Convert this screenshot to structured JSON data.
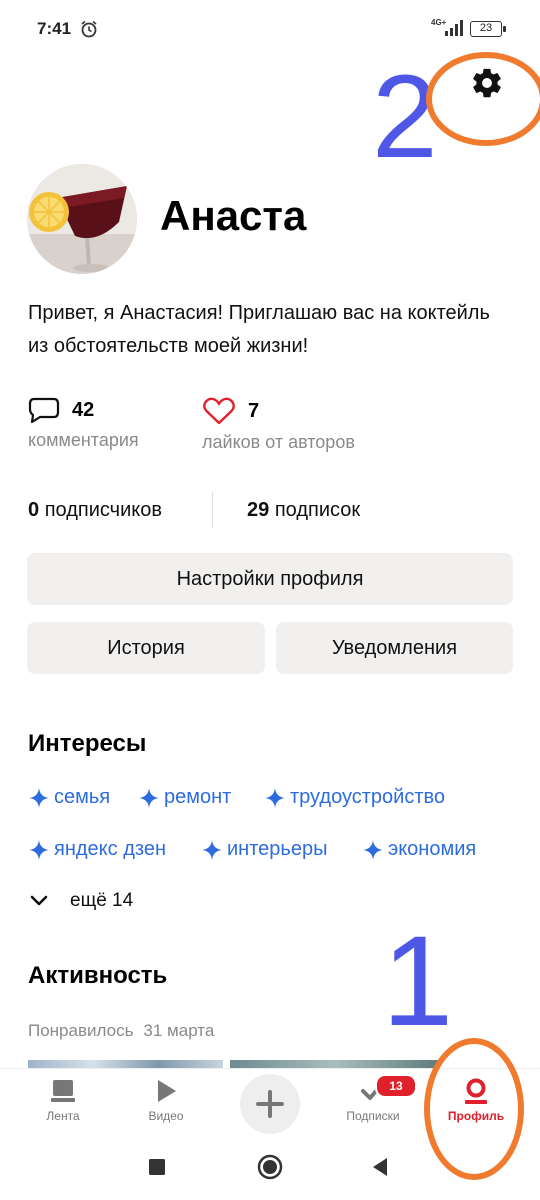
{
  "status_bar": {
    "time": "7:41",
    "network": "4G+",
    "battery": "23"
  },
  "profile": {
    "name": "Анаста",
    "bio": "Привет, я Анастасия! Приглашаю вас на коктейль из обстоятельств моей жизни!",
    "comments": {
      "count": "42",
      "label": "комментария"
    },
    "likes": {
      "count": "7",
      "label": "лайков от авторов"
    },
    "subscribers": {
      "count": "0",
      "label": "подписчиков"
    },
    "subscriptions": {
      "count": "29",
      "label": "подписок"
    }
  },
  "buttons": {
    "profile_settings": "Настройки профиля",
    "history": "История",
    "notifications": "Уведомления"
  },
  "interests": {
    "title": "Интересы",
    "tags": [
      "семья",
      "ремонт",
      "трудоустройство",
      "яндекс дзен",
      "интерьеры",
      "экономия"
    ],
    "more_label": "ещё 14"
  },
  "activity": {
    "title": "Активность",
    "liked_label": "Понравилось",
    "liked_date": "31 марта"
  },
  "tabbar": {
    "items": [
      {
        "label": "Лента",
        "icon": "feed-icon"
      },
      {
        "label": "Видео",
        "icon": "play-icon"
      },
      {
        "label": "",
        "icon": "plus-icon"
      },
      {
        "label": "Подписки",
        "icon": "check-icon",
        "badge": "13"
      },
      {
        "label": "Профиль",
        "icon": "profile-icon",
        "active": true
      }
    ]
  },
  "annotations": {
    "marker_top": "2",
    "marker_bottom": "1"
  },
  "colors": {
    "accent": "#e0202a",
    "link": "#2d6ce0",
    "annotation_number": "#4f58e6",
    "annotation_oval": "#f07a2e"
  }
}
